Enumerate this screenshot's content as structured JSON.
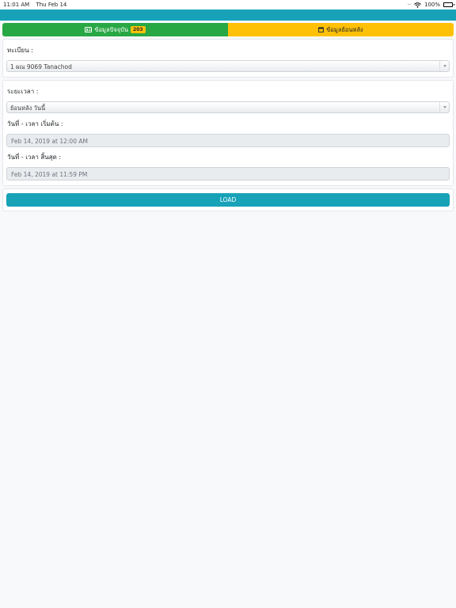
{
  "status_bar": {
    "time": "11:01 AM",
    "date": "Thu Feb 14",
    "battery": "100%"
  },
  "tabs": {
    "current_label": "ข้อมูลปัจจุบัน",
    "current_badge": "203",
    "history_label": "ข้อมูลย้อนหลัง"
  },
  "vehicle": {
    "label": "ทะเบียน :",
    "selected": "1 ผณ 9069 Tanachod"
  },
  "period": {
    "label": "ระยะเวลา :",
    "selected": "ย้อนหลัง วันนี้",
    "start_label": "วันที่ - เวลา เริ่มต้น :",
    "start_value": "Feb 14, 2019 at 12:00 AM",
    "end_label": "วันที่ - เวลา สิ้นสุด :",
    "end_value": "Feb 14, 2019 at 11:59 PM"
  },
  "actions": {
    "load_label": "LOAD"
  },
  "colors": {
    "navbar": "#17a2b8",
    "tab_current": "#28a745",
    "tab_history": "#ffc107",
    "load_button": "#17a2b8"
  },
  "icons": [
    "wifi-icon",
    "battery-icon",
    "id-card-icon",
    "calendar-icon",
    "dropdown-arrow-icon"
  ]
}
